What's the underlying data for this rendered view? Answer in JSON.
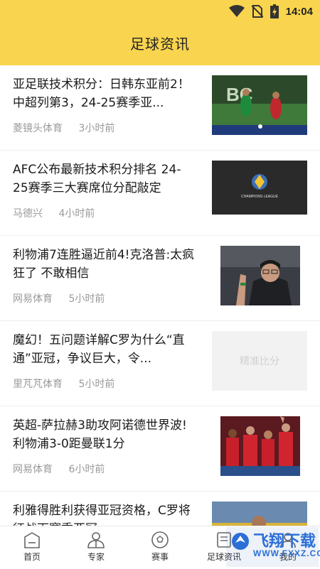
{
  "status_bar": {
    "time": "14:04"
  },
  "header": {
    "title": "足球资讯"
  },
  "feed": {
    "items": [
      {
        "title": "亚足联技术积分：日韩东亚前2！中超列第3，24-25赛季亚...",
        "source": "菱镜头体育",
        "time": "3小时前",
        "thumb": "photo"
      },
      {
        "title": "AFC公布最新技术积分排名 24-25赛季三大赛席位分配敲定",
        "source": "马德兴",
        "time": "4小时前",
        "thumb": "photo",
        "thumb_text": "CHAMPIONS LEAGUE"
      },
      {
        "title": "利物浦7连胜逼近前4!克洛普:太疯狂了 不敢相信",
        "source": "网易体育",
        "time": "5小时前",
        "thumb": "photo"
      },
      {
        "title": "魔幻！五问题详解C罗为什么“直通”亚冠，争议巨大，令...",
        "source": "里芃芃体育",
        "time": "5小时前",
        "thumb": "placeholder",
        "thumb_text": "精准比分"
      },
      {
        "title": "英超-萨拉赫3助攻阿诺德世界波!利物浦3-0距曼联1分",
        "source": "网易体育",
        "time": "6小时前",
        "thumb": "photo"
      },
      {
        "title": "利雅得胜利获得亚冠资格，C罗将征战下赛季亚冠",
        "source": "",
        "time": "",
        "thumb": "photo"
      }
    ]
  },
  "tabbar": {
    "tabs": [
      {
        "label": "首页"
      },
      {
        "label": "专家"
      },
      {
        "label": "赛事"
      },
      {
        "label": "足球资讯"
      },
      {
        "label": "我的"
      }
    ]
  },
  "watermark": {
    "text": "飞翔下载",
    "url": "WWW.FXXZ.COM"
  },
  "colors": {
    "header": "#f9d44e",
    "meta": "#9a9a9a"
  }
}
